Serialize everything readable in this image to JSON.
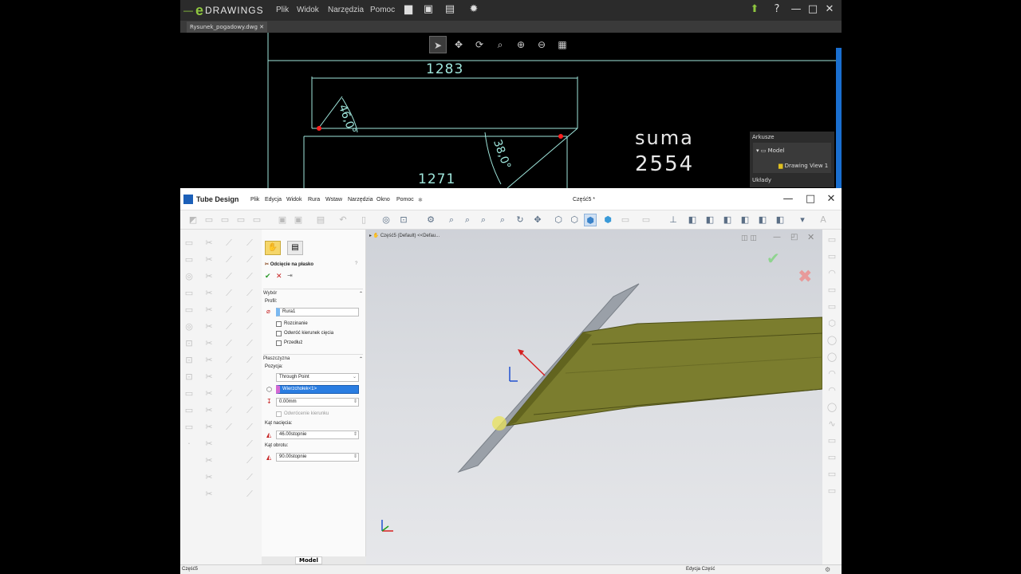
{
  "edrawings": {
    "logo": "DRAWINGS",
    "menu": [
      "Plik",
      "Widok",
      "Narzędzia",
      "Pomoc"
    ],
    "tab": "Rysunek_pogadowy.dwg",
    "drawing": {
      "dim_top": "1283",
      "dim_bottom": "1271",
      "angle_left": "46,0°",
      "angle_right": "38,0°",
      "sum_label": "suma",
      "sum_value": "2554"
    },
    "sheets_panel": {
      "title": "Arkusze",
      "model": "Model",
      "view": "Drawing View 1",
      "layouts": "Układy"
    }
  },
  "tube_design": {
    "app_title": "Tube Design",
    "doc_title": "Część5 *",
    "menu": [
      "Plik",
      "Edycja",
      "Widok",
      "Rura",
      "Wstaw",
      "Narzędzia",
      "Okno",
      "Pomoc"
    ],
    "feature_tree_path": "Część5 (Default) <<Defau...",
    "property_manager": {
      "title": "Odcięcie na płasko",
      "help": "?",
      "section_selection": "Wybór",
      "profile_label": "Profil:",
      "profile_value": "Rura1",
      "cb_unfold": "Rozcinanie",
      "cb_reverse_cut": "Odwróć kierunek cięcia",
      "cb_extend": "Przedłuż",
      "section_plane": "Płaszczyzna",
      "position_label": "Pozycja:",
      "position_value": "Through Point",
      "vertex_value": "Wierzchołek<1>",
      "offset_value": "0.00mm",
      "reverse_dir": "Odwrócenie kierunku",
      "cut_angle_label": "Kąt nacięcia:",
      "cut_angle_value": "46.00stopnie",
      "rot_angle_label": "Kąt obrotu:",
      "rot_angle_value": "90.00stopnie"
    },
    "bottom_tab": "Model",
    "status_left": "Część5",
    "status_right": "Edycja Część"
  },
  "colors": {
    "drawing_line": "#9fe6dc",
    "tube_fill": "#7b7d2e",
    "plane_fill": "#9aa0a8",
    "highlight": "#2a7de1"
  }
}
